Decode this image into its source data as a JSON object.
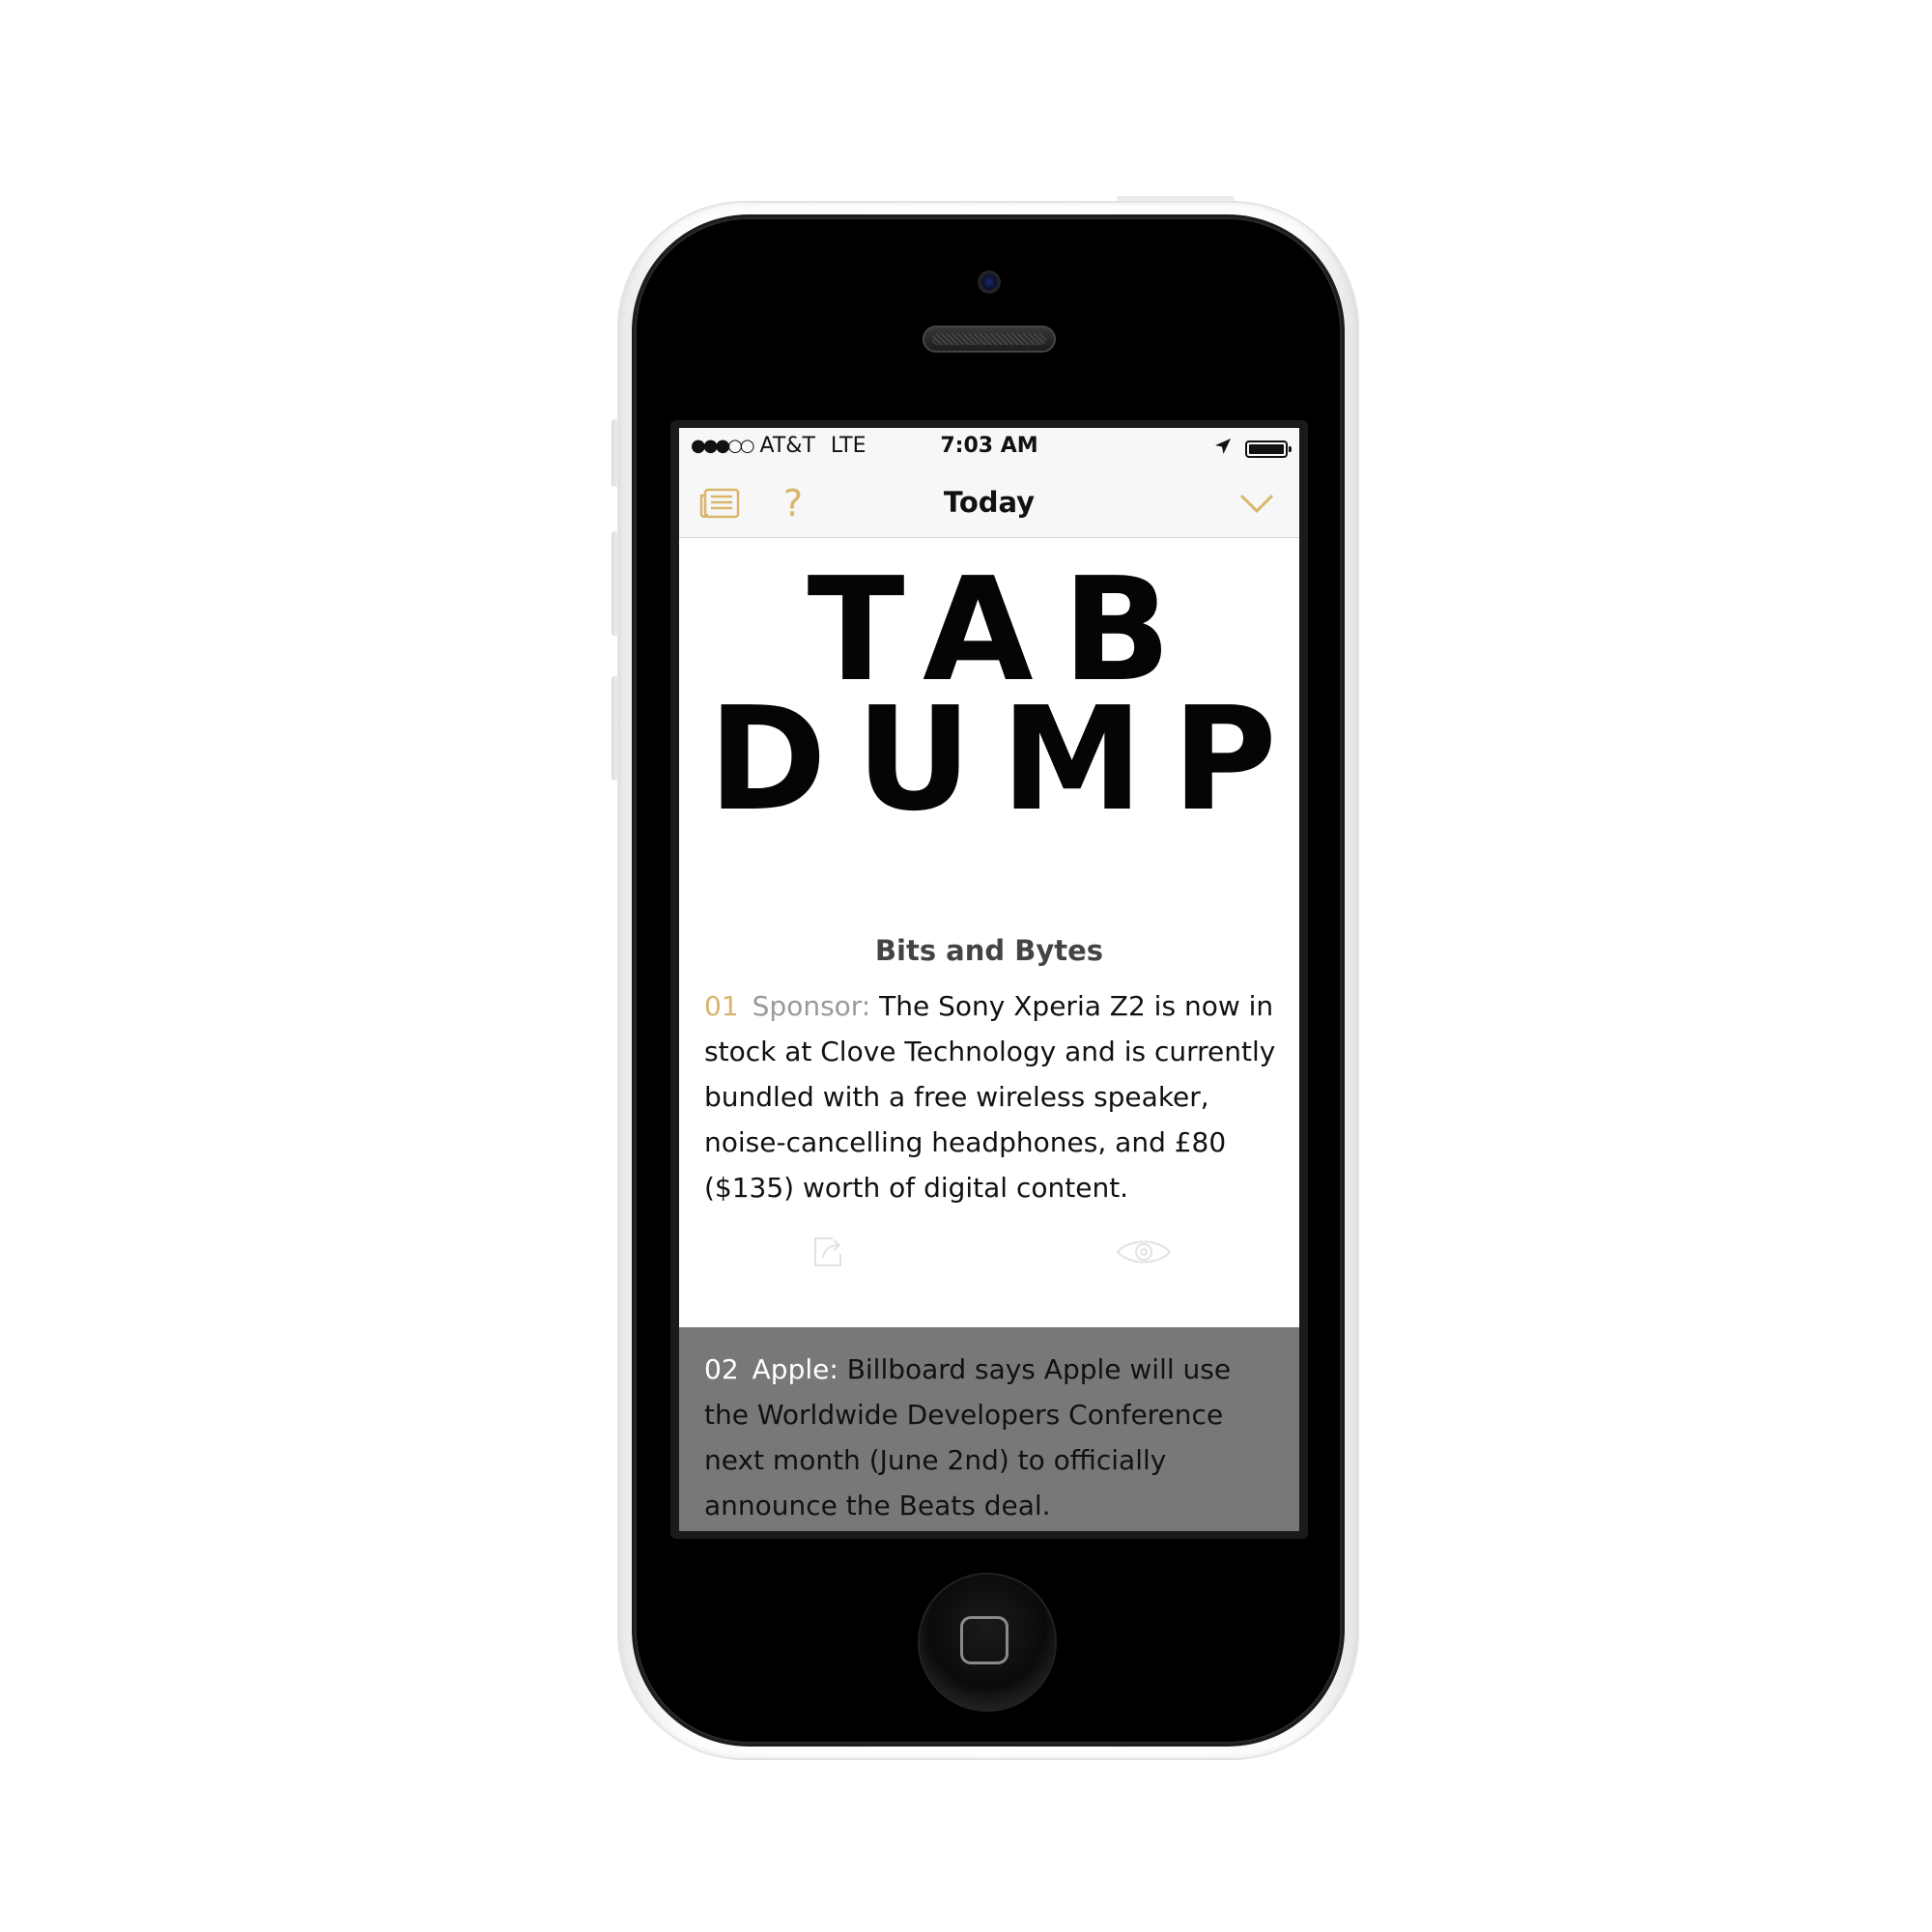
{
  "status_bar": {
    "signal": "●●●○○",
    "carrier": "AT&T",
    "network": "LTE",
    "time": "7:03 AM"
  },
  "nav": {
    "title": "Today",
    "help_label": "?"
  },
  "logo": {
    "line1": "TAB",
    "line2": "DUMP"
  },
  "section": {
    "title": "Bits and Bytes"
  },
  "items": [
    {
      "number": "01",
      "source": "Sponsor:",
      "text": "The Sony Xperia Z2 is now in stock at Clove Technology and is currently bundled with a free wireless speaker, noise-cancelling headphones, and £80 ($135) worth of digital content."
    },
    {
      "number": "02",
      "source": "Apple:",
      "text": "Billboard says Apple will use the Worldwide Developers Conference next month (June 2nd) to officially announce the Beats deal."
    }
  ],
  "colors": {
    "accent": "#d9b56a",
    "highlight_row": "#787878",
    "nav_background": "#f7f7f7"
  },
  "icons": {
    "nav_left": "newspaper-icon",
    "nav_help": "help-icon",
    "nav_right": "chevron-down-icon",
    "item_share": "share-icon",
    "item_read": "eye-icon",
    "location": "location-arrow-icon",
    "battery": "battery-icon"
  }
}
